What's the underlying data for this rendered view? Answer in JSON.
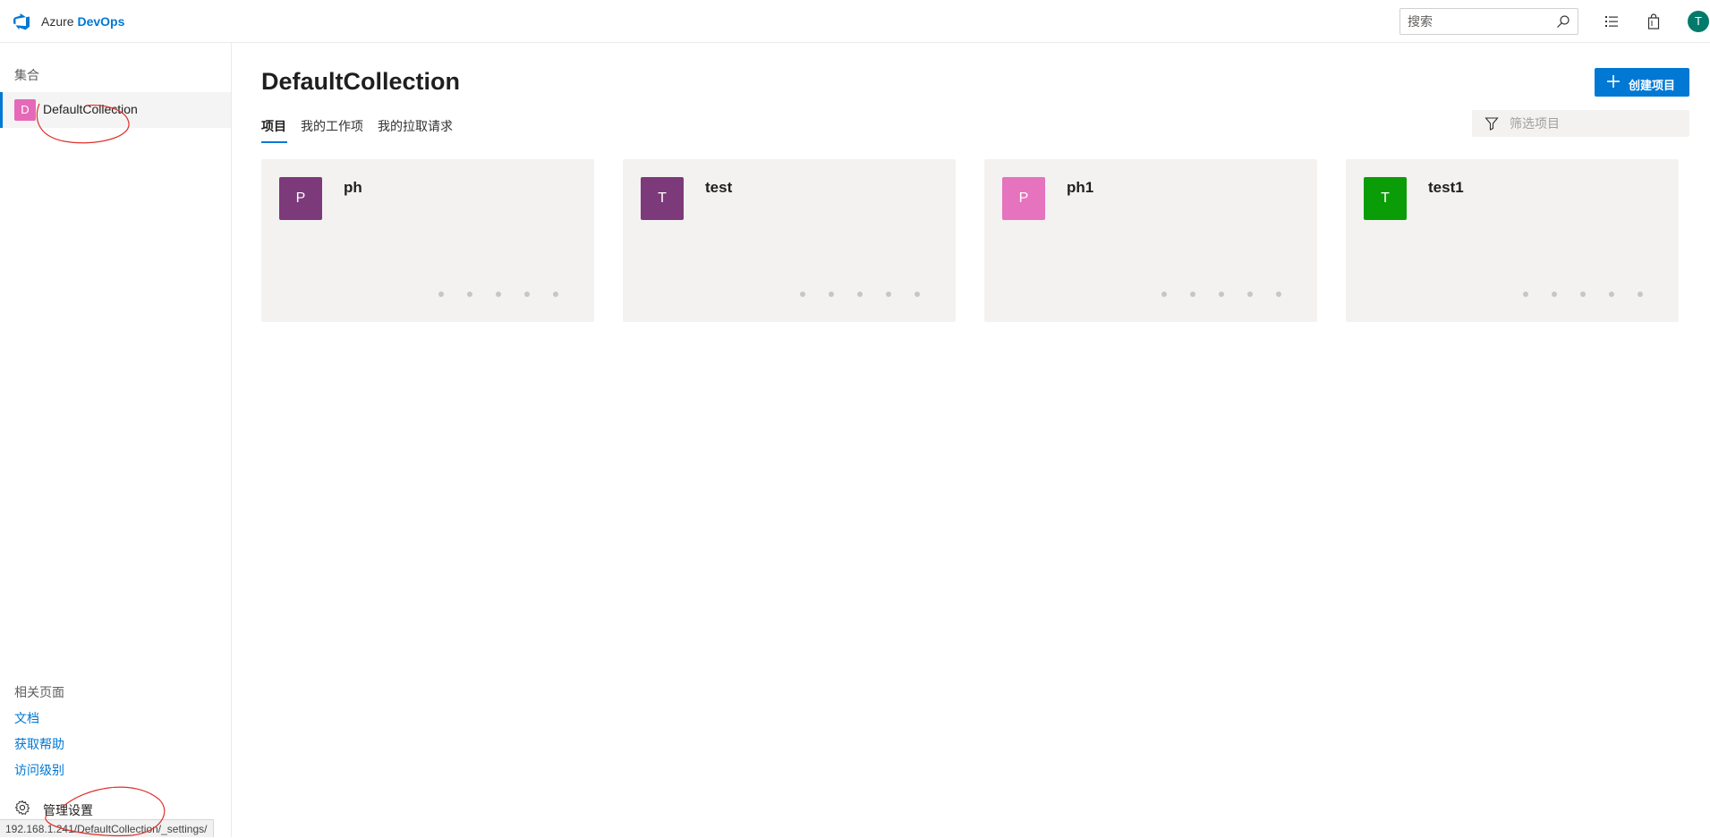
{
  "header": {
    "brand_part1": "Azure",
    "brand_part2": "DevOps",
    "search_placeholder": "搜索",
    "user_initial": "T"
  },
  "sidebar": {
    "section_title": "集合",
    "collections": [
      {
        "initial": "D",
        "label": "DefaultCollection"
      }
    ],
    "related_title": "相关页面",
    "links": [
      "文档",
      "获取帮助",
      "访问级别"
    ],
    "admin_label": "管理设置",
    "status_url": "192.168.1.241/DefaultCollection/_settings/"
  },
  "main": {
    "title": "DefaultCollection",
    "create_button": "创建项目",
    "tabs": [
      "项目",
      "我的工作项",
      "我的拉取请求"
    ],
    "filter_placeholder": "筛选项目",
    "projects": [
      {
        "initial": "P",
        "name": "ph",
        "color": "#7d3a7a"
      },
      {
        "initial": "T",
        "name": "test",
        "color": "#7d3a7a"
      },
      {
        "initial": "P",
        "name": "ph1",
        "color": "#e573bd"
      },
      {
        "initial": "T",
        "name": "test1",
        "color": "#0a9d07"
      }
    ]
  },
  "colors": {
    "accent": "#0078d4",
    "annotation": "#e0302a"
  }
}
